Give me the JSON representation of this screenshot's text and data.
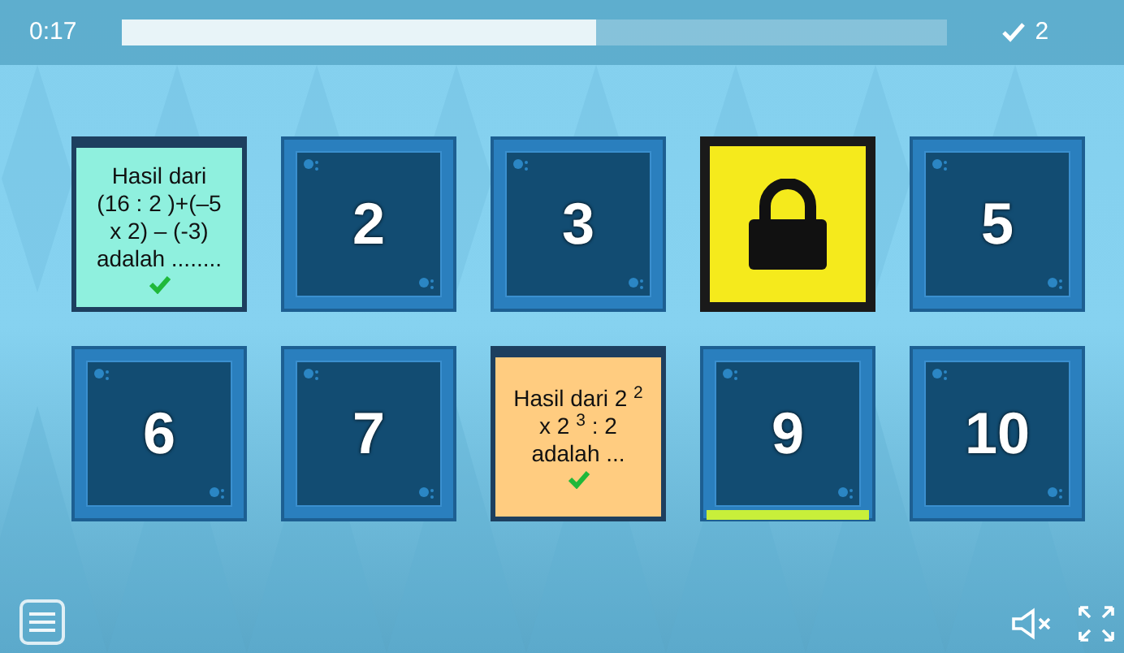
{
  "top_bar": {
    "timer": "0:17",
    "level": 0.575,
    "score": "2"
  },
  "tiles": [
    {
      "kind": "answered",
      "color": "#8ff0de",
      "text": "Hasil dari (16 : 2 )+(–5 x 2) – (-3) adalah ........",
      "correct": true
    },
    {
      "kind": "number",
      "label": "2"
    },
    {
      "kind": "number",
      "label": "3"
    },
    {
      "kind": "locked"
    },
    {
      "kind": "number",
      "label": "5"
    },
    {
      "kind": "number",
      "label": "6"
    },
    {
      "kind": "number",
      "label": "7"
    },
    {
      "kind": "answered",
      "color": "#ffcc80",
      "text": "Hasil dari 2 $^{2}$ x 2 $^{3}$ : 2 adalah ...",
      "correct": true
    },
    {
      "kind": "number",
      "label": "9",
      "level": 1
    },
    {
      "kind": "number",
      "label": "10"
    }
  ]
}
